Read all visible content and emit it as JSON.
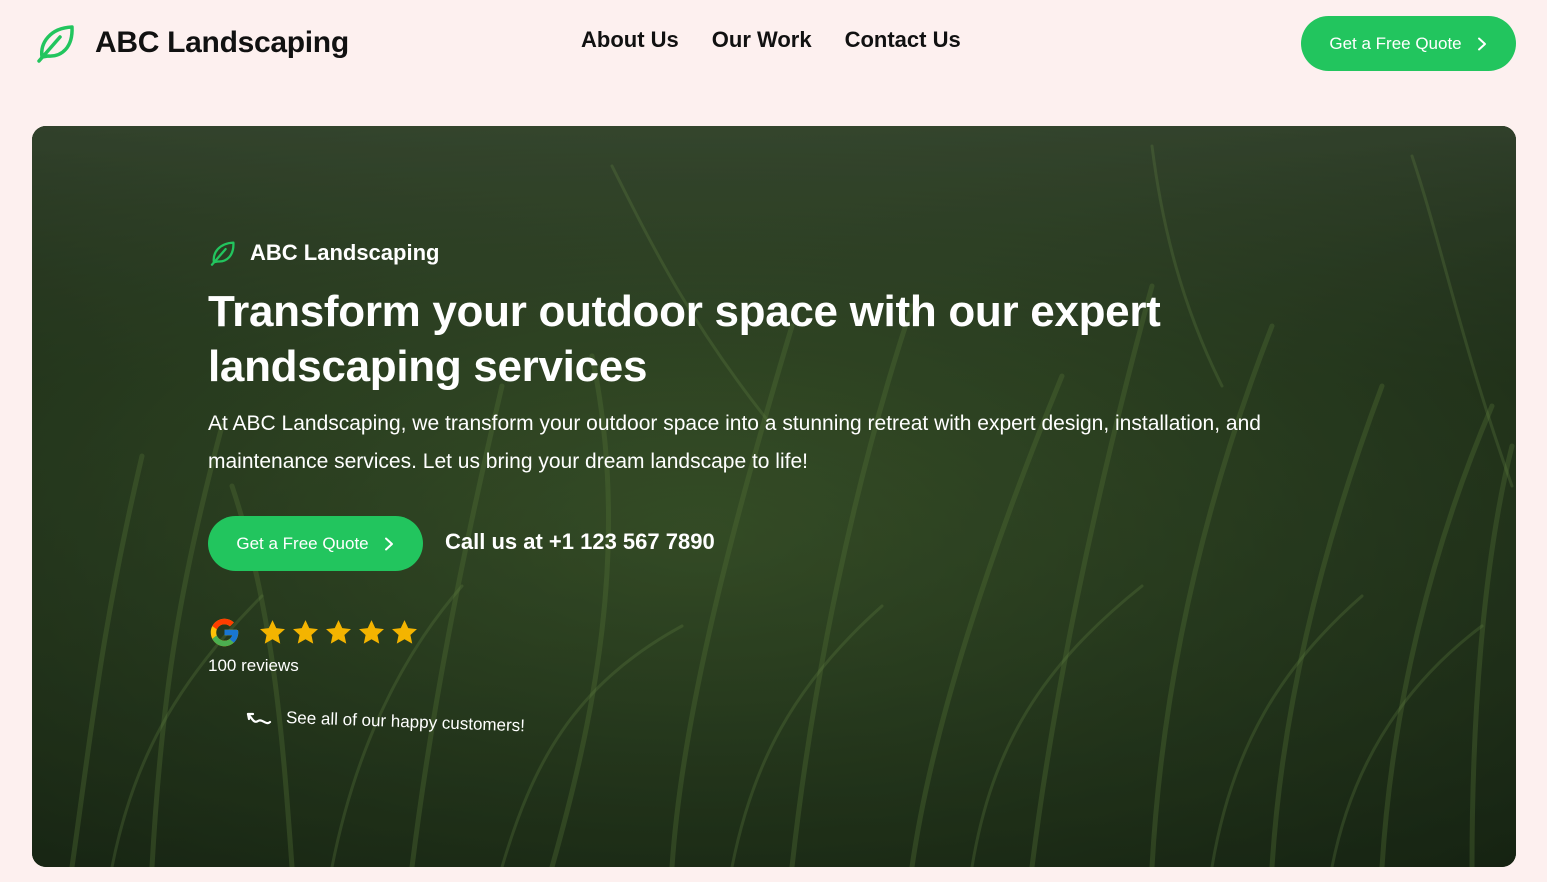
{
  "header": {
    "brand_name": "ABC Landscaping",
    "brand_icon": "leaf-icon",
    "nav": [
      {
        "label": "About Us"
      },
      {
        "label": "Our Work"
      },
      {
        "label": "Contact Us"
      }
    ],
    "cta_label": "Get a Free Quote",
    "cta_icon": "chevron-right-icon"
  },
  "hero": {
    "brand_name": "ABC Landscaping",
    "title": "Transform your outdoor space with our expert landscaping services",
    "description": "At ABC Landscaping, we transform your outdoor space into a stunning retreat with expert design, installation, and maintenance services. Let us bring your dream landscape to life!",
    "cta_label": "Get a Free Quote",
    "phone_text": "Call us at +1 123 567 7890",
    "rating": {
      "source_icon": "google-g-icon",
      "stars": 5,
      "max_stars": 5,
      "reviews_text": "100 reviews"
    },
    "customers_link": "See all of our happy customers!",
    "customers_icon": "squiggle-arrow-icon"
  },
  "colors": {
    "page_background": "#fdf0ef",
    "accent_green": "#22c55e",
    "star_gold": "#f4b400",
    "text_dark": "#111111",
    "hero_text": "#ffffff"
  }
}
